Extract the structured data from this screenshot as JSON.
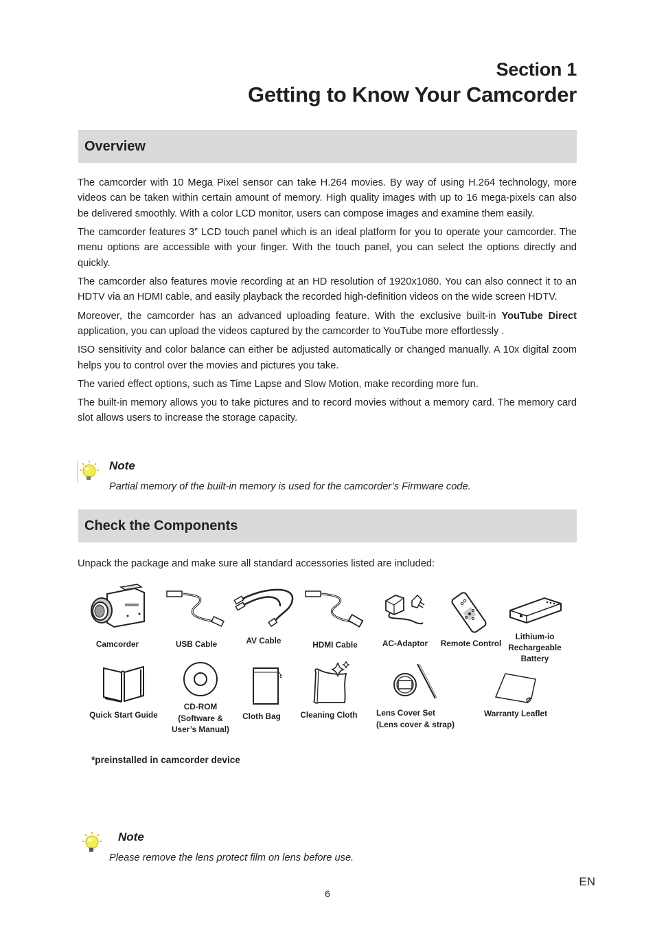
{
  "header": {
    "section_number": "Section 1",
    "section_title": "Getting to Know Your Camcorder"
  },
  "overview": {
    "heading": "Overview",
    "paragraphs": [
      "The camcorder with 10 Mega Pixel sensor can take H.264 movies. By way of using H.264 technology, more videos can be taken within certain amount of memory. High quality images with up to 16 mega-pixels can also be delivered smoothly. With a color LCD monitor, users can compose images and examine them easily.",
      "The camcorder features 3” LCD touch panel which is an ideal platform for you to operate your camcorder. The menu options are accessible with your finger. With the touch panel, you can select the options directly and quickly.",
      "The camcorder also features movie recording at an HD resolution of 1920x1080. You can also connect it to an HDTV via an HDMI cable, and easily playback the recorded high-definition videos on the wide screen HDTV."
    ],
    "youtube_paragraph": {
      "before": "Moreover, the camcorder has an advanced uploading feature. With the exclusive built-in ",
      "bold": "YouTube Direct",
      "after": " application, you can upload the videos captured by the camcorder to YouTube more effortlessly ."
    },
    "paragraphs_after": [
      "ISO sensitivity and color balance can either be adjusted automatically or changed manually. A 10x digital zoom helps you to control over the movies and pictures you take.",
      "The varied effect options, such as Time Lapse and Slow Motion, make recording more fun.",
      "The built-in memory allows you to take pictures and to record movies without a memory card. The memory card slot allows users to increase the storage capacity."
    ],
    "note": {
      "title": "Note",
      "text": "Partial memory of the built-in memory is used for the camcorder’s Firmware code."
    }
  },
  "components": {
    "heading": "Check the Components",
    "intro": "Unpack the package and make sure all standard accessories listed are included:",
    "items": [
      {
        "label": "Camcorder",
        "icon": "camcorder-icon"
      },
      {
        "label": "USB Cable",
        "icon": "usb-cable-icon"
      },
      {
        "label": "AV Cable",
        "icon": "av-cable-icon"
      },
      {
        "label": "HDMI Cable",
        "icon": "hdmi-cable-icon"
      },
      {
        "label": "AC-Adaptor",
        "icon": "ac-adaptor-icon"
      },
      {
        "label": "Remote Control",
        "icon": "remote-control-icon"
      },
      {
        "label": "Lithium-io\nRechargeable\nBattery",
        "icon": "battery-icon"
      },
      {
        "label": "Quick Start Guide",
        "icon": "book-icon"
      },
      {
        "label": "CD-ROM\n(Software &\nUser’s Manual)",
        "icon": "cd-rom-icon"
      },
      {
        "label": "Cloth Bag",
        "icon": "cloth-bag-icon"
      },
      {
        "label": "Cleaning Cloth",
        "icon": "cleaning-cloth-icon"
      },
      {
        "label": "Lens Cover Set\n(Lens cover & strap)",
        "icon": "lens-cover-icon"
      },
      {
        "label": "Warranty Leaflet",
        "icon": "leaflet-icon"
      }
    ],
    "footnote": "*preinstalled in camcorder device",
    "note": {
      "title": "Note",
      "text": "Please remove the lens protect film on lens before use."
    }
  },
  "footer": {
    "language": "EN",
    "page_number": "6"
  }
}
